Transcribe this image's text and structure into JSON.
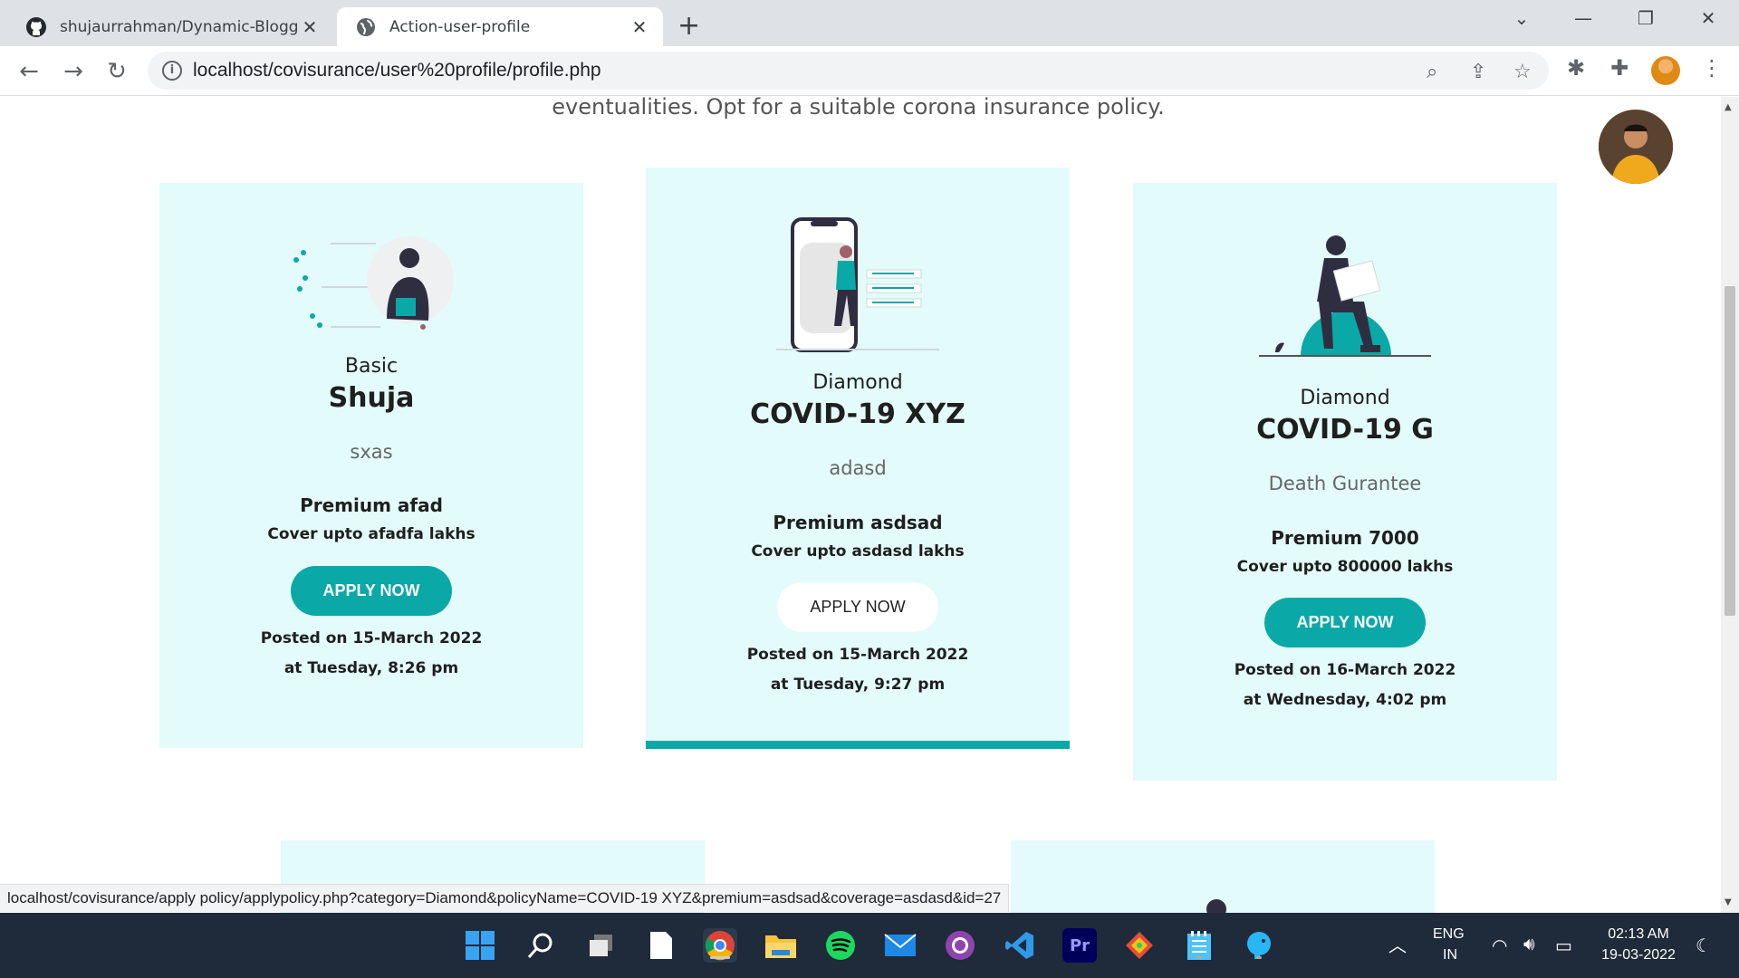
{
  "browser": {
    "tabs": [
      {
        "title": "shujaurrahman/Dynamic-Blogger",
        "icon": "github-icon"
      },
      {
        "title": "Action-user-profile",
        "icon": "globe-icon"
      }
    ],
    "url": "localhost/covisurance/user%20profile/profile.php",
    "status_url": "localhost/covisurance/apply policy/applypolicy.php?category=Diamond&policyName=COVID-19 XYZ&premium=asdsad&coverage=asdasd&id=27"
  },
  "page": {
    "intro": "eventualities. Opt for a suitable corona insurance policy.",
    "cards": [
      {
        "category": "Basic",
        "name": "Shuja",
        "description": "sxas",
        "premium": "Premium afad",
        "cover": "Cover upto afadfa lakhs",
        "button": "APPLY NOW",
        "posted_date": "Posted on 15-March 2022",
        "posted_time": "at Tuesday, 8:26 pm"
      },
      {
        "category": "Diamond",
        "name": "COVID-19 XYZ",
        "description": "adasd",
        "premium": "Premium asdsad",
        "cover": "Cover upto asdasd lakhs",
        "button": "APPLY NOW",
        "posted_date": "Posted on 15-March 2022",
        "posted_time": "at Tuesday, 9:27 pm"
      },
      {
        "category": "Diamond",
        "name": "COVID-19 G",
        "description": "Death Gurantee",
        "premium": "Premium 7000",
        "cover": "Cover upto 800000 lakhs",
        "button": "APPLY NOW",
        "posted_date": "Posted on 16-March 2022",
        "posted_time": "at Wednesday, 4:02 pm"
      }
    ]
  },
  "taskbar": {
    "lang": "ENG",
    "region": "IN",
    "time": "02:13 AM",
    "date": "19-03-2022"
  },
  "colors": {
    "accent": "#0aa8a7",
    "card_bg": "#e3fbfa",
    "taskbar": "#1f2a3a"
  }
}
